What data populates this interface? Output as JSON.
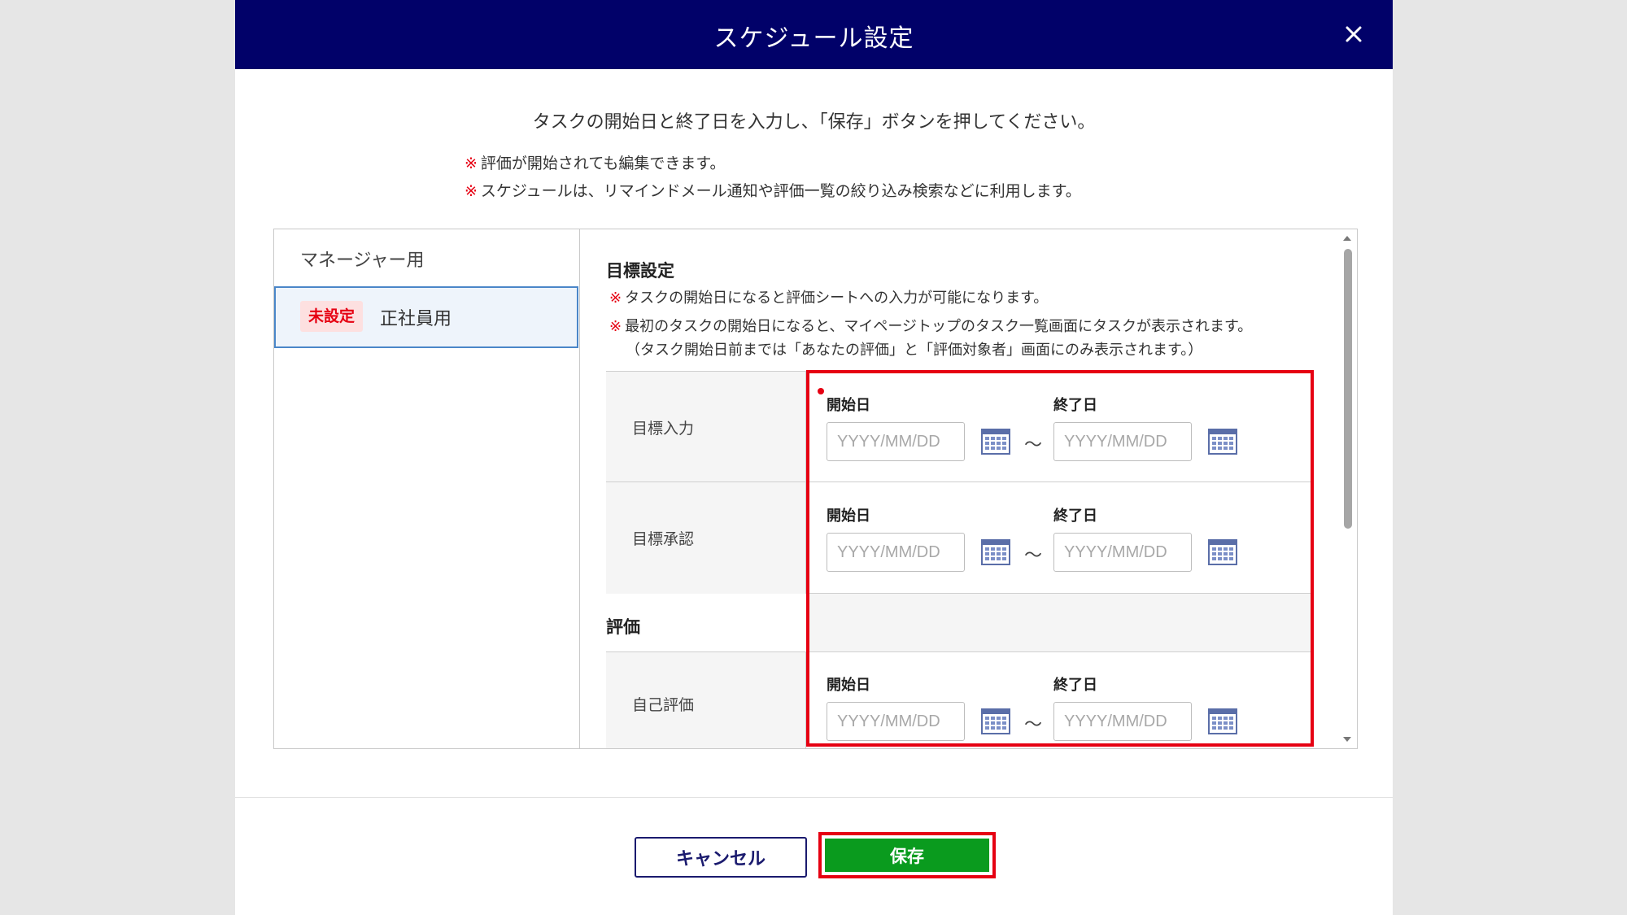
{
  "modal": {
    "title": "スケジュール設定",
    "intro": "タスクの開始日と終了日を入力し、「保存」ボタンを押してください。",
    "notes": [
      "評価が開始されても編集できます。",
      "スケジュールは、リマインドメール通知や評価一覧の絞り込み検索などに利用します。"
    ],
    "note_mark": "※"
  },
  "sidebar": {
    "items": [
      {
        "label": "マネージャー用"
      },
      {
        "label": "正社員用",
        "badge": "未設定"
      }
    ]
  },
  "content": {
    "section_goal": {
      "title": "目標設定",
      "notes": [
        "タスクの開始日になると評価シートへの入力が可能になります。",
        "最初のタスクの開始日になると、マイページトップのタスク一覧画面にタスクが表示されます。",
        "（タスク開始日前までは「あなたの評価」と「評価対象者」画面にのみ表示されます。）"
      ]
    },
    "section_eval": {
      "title": "評価"
    },
    "rows": [
      {
        "label": "目標入力",
        "start_label": "開始日",
        "end_label": "終了日",
        "placeholder": "YYYY/MM/DD",
        "tilde": "～"
      },
      {
        "label": "目標承認",
        "start_label": "開始日",
        "end_label": "終了日",
        "placeholder": "YYYY/MM/DD",
        "tilde": "～"
      },
      {
        "label": "自己評価",
        "start_label": "開始日",
        "end_label": "終了日",
        "placeholder": "YYYY/MM/DD",
        "tilde": "～"
      }
    ]
  },
  "footer": {
    "cancel_label": "キャンセル",
    "save_label": "保存"
  },
  "colors": {
    "header_bg": "#010169",
    "accent_red": "#e60012",
    "save_green": "#0a9b1e",
    "selected_border": "#4a86c8"
  },
  "icons": [
    "close-icon",
    "calendar-icon",
    "scroll-up-icon",
    "scroll-down-icon"
  ]
}
